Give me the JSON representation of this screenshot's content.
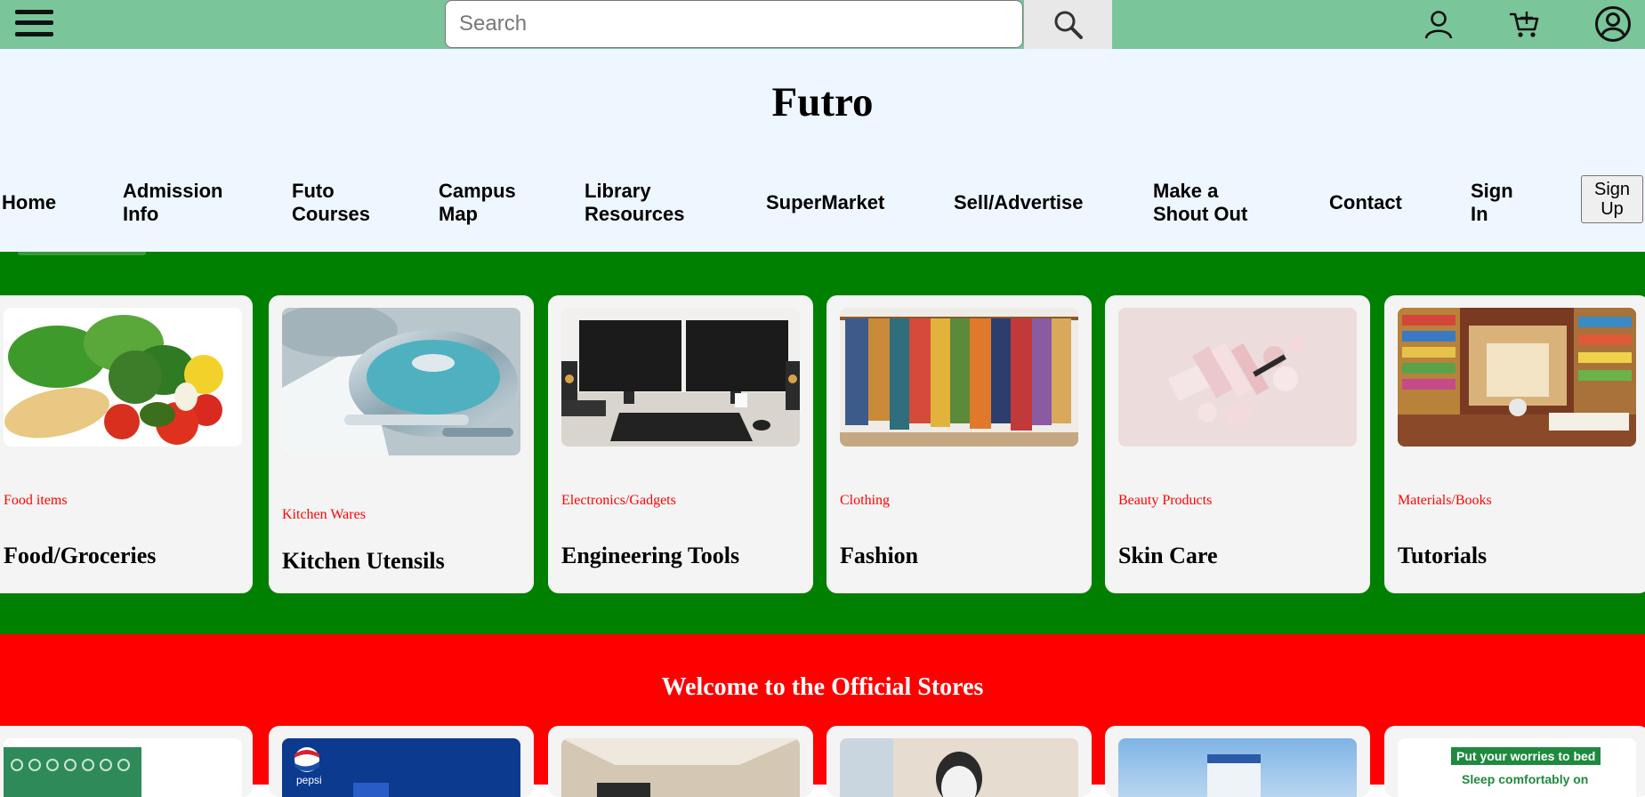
{
  "topbar": {
    "menu_icon": "hamburger-menu-icon",
    "search_placeholder": "Search",
    "search_icon": "search-icon",
    "user_icon": "user-icon",
    "cart_icon": "cart-icon",
    "account_icon": "account-circle-icon"
  },
  "header": {
    "title": "Futro",
    "nav": [
      {
        "line1": "Home",
        "line2": ""
      },
      {
        "line1": "Admission",
        "line2": "Info"
      },
      {
        "line1": "Futo",
        "line2": "Courses"
      },
      {
        "line1": "Campus",
        "line2": "Map"
      },
      {
        "line1": "Library",
        "line2": "Resources"
      },
      {
        "line1": "SuperMarket",
        "line2": ""
      },
      {
        "line1": "Sell/Advertise",
        "line2": ""
      },
      {
        "line1": "Make a",
        "line2": "Shout Out"
      },
      {
        "line1": "Contact",
        "line2": ""
      },
      {
        "line1": "Sign",
        "line2": "In"
      }
    ],
    "signup": {
      "line1": "Sign",
      "line2": "Up"
    }
  },
  "categories": [
    {
      "subtitle": "Food items",
      "title": "Food/Groceries"
    },
    {
      "subtitle": "Kitchen Wares",
      "title": "Kitchen Utensils"
    },
    {
      "subtitle": "Electronics/Gadgets",
      "title": "Engineering Tools"
    },
    {
      "subtitle": "Clothing",
      "title": "Fashion"
    },
    {
      "subtitle": "Beauty Products",
      "title": "Skin Care"
    },
    {
      "subtitle": "Materials/Books",
      "title": "Tutorials"
    }
  ],
  "stores": {
    "title": "Welcome to the Official Stores",
    "pepsi_label": "pepsi",
    "banner_line1": "Put your worries to bed",
    "banner_line2": "Sleep comfortably on"
  },
  "colors": {
    "topbar": "#7ac59a",
    "header": "#eef6ff",
    "categories_bg": "#008000",
    "stores_bg": "#ff0000",
    "subtitle": "#ff0000"
  }
}
